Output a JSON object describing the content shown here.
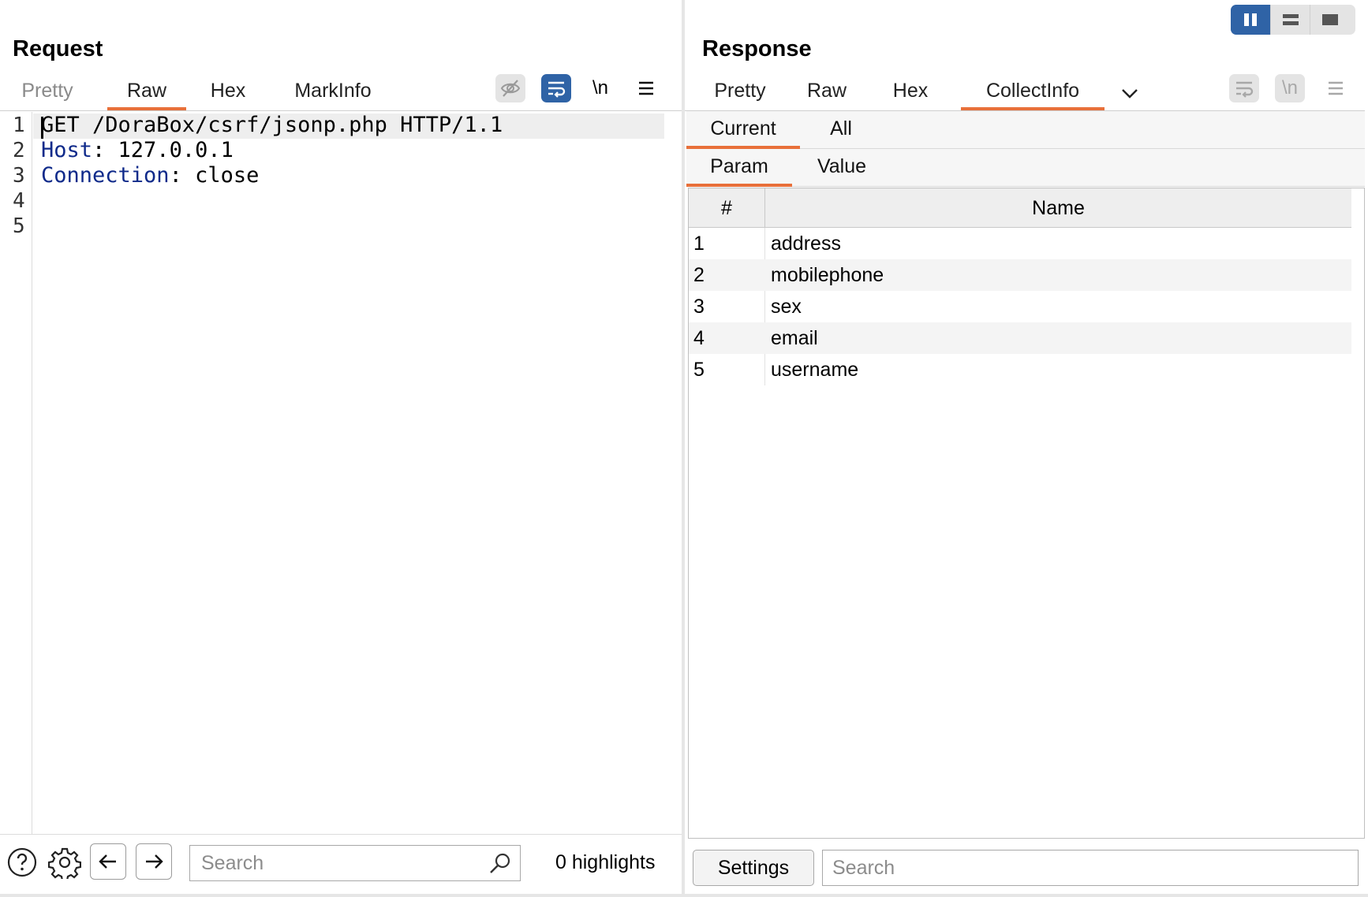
{
  "request": {
    "title": "Request",
    "tabs": [
      {
        "label": "Pretty",
        "state": "dim"
      },
      {
        "label": "Raw",
        "state": "active"
      },
      {
        "label": "Hex",
        "state": "normal"
      },
      {
        "label": "MarkInfo",
        "state": "normal"
      }
    ],
    "toolbar": {
      "newline_label": "\\n",
      "icons": [
        "eye-slash-icon",
        "wrap-lines-icon",
        "newline-icon",
        "menu-icon"
      ]
    },
    "lines": [
      {
        "num": "1",
        "method_line": "GET /DoraBox/csrf/jsonp.php HTTP/1.1"
      },
      {
        "num": "2",
        "key": "Host",
        "value": ": 127.0.0.1"
      },
      {
        "num": "3",
        "key": "Connection",
        "value": ": close"
      },
      {
        "num": "4"
      },
      {
        "num": "5"
      }
    ],
    "footer": {
      "search_placeholder": "Search",
      "highlights": "0 highlights"
    }
  },
  "response": {
    "title": "Response",
    "tabs": [
      {
        "label": "Pretty",
        "state": "normal"
      },
      {
        "label": "Raw",
        "state": "normal"
      },
      {
        "label": "Hex",
        "state": "normal"
      },
      {
        "label": "CollectInfo",
        "state": "active"
      }
    ],
    "toolbar": {
      "newline_label": "\\n"
    },
    "scope_tabs": [
      {
        "label": "Current",
        "state": "active"
      },
      {
        "label": "All",
        "state": "normal"
      }
    ],
    "view_tabs": [
      {
        "label": "Param",
        "state": "active"
      },
      {
        "label": "Value",
        "state": "normal"
      }
    ],
    "table": {
      "columns": [
        "#",
        "Name"
      ],
      "rows": [
        {
          "num": "1",
          "name": "address"
        },
        {
          "num": "2",
          "name": "mobilephone"
        },
        {
          "num": "3",
          "name": "sex"
        },
        {
          "num": "4",
          "name": "email"
        },
        {
          "num": "5",
          "name": "username"
        }
      ]
    },
    "footer": {
      "settings_label": "Settings",
      "search_placeholder": "Search"
    }
  },
  "colors": {
    "accent": "#e8703a",
    "toggle_blue": "#2f63a6",
    "header_key": "#0f2a8a"
  }
}
